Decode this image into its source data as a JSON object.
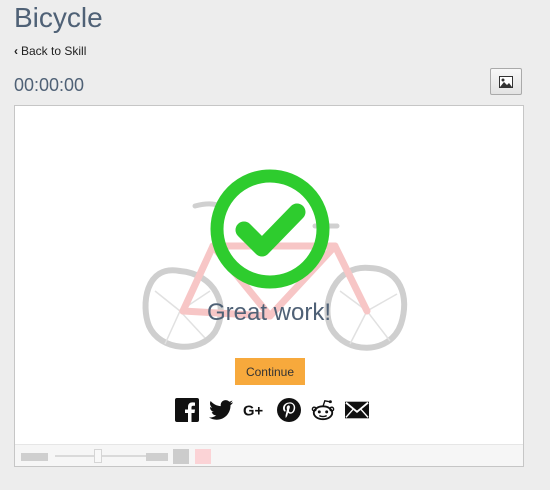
{
  "page": {
    "title": "Bicycle",
    "back_label": "Back to Skill",
    "timer": "00:00:00"
  },
  "result": {
    "message": "Great work!",
    "continue_label": "Continue"
  },
  "share": [
    {
      "name": "facebook",
      "icon": "facebook-icon"
    },
    {
      "name": "twitter",
      "icon": "twitter-icon"
    },
    {
      "name": "google-plus",
      "icon": "google-plus-icon"
    },
    {
      "name": "pinterest",
      "icon": "pinterest-icon"
    },
    {
      "name": "reddit",
      "icon": "reddit-icon"
    },
    {
      "name": "email",
      "icon": "email-icon"
    }
  ],
  "colors": {
    "title": "#4f6176",
    "check_green": "#2ecc2e",
    "continue_bg": "#f7a93c",
    "frame_bg": "#ffffff",
    "page_bg": "#ededed"
  }
}
